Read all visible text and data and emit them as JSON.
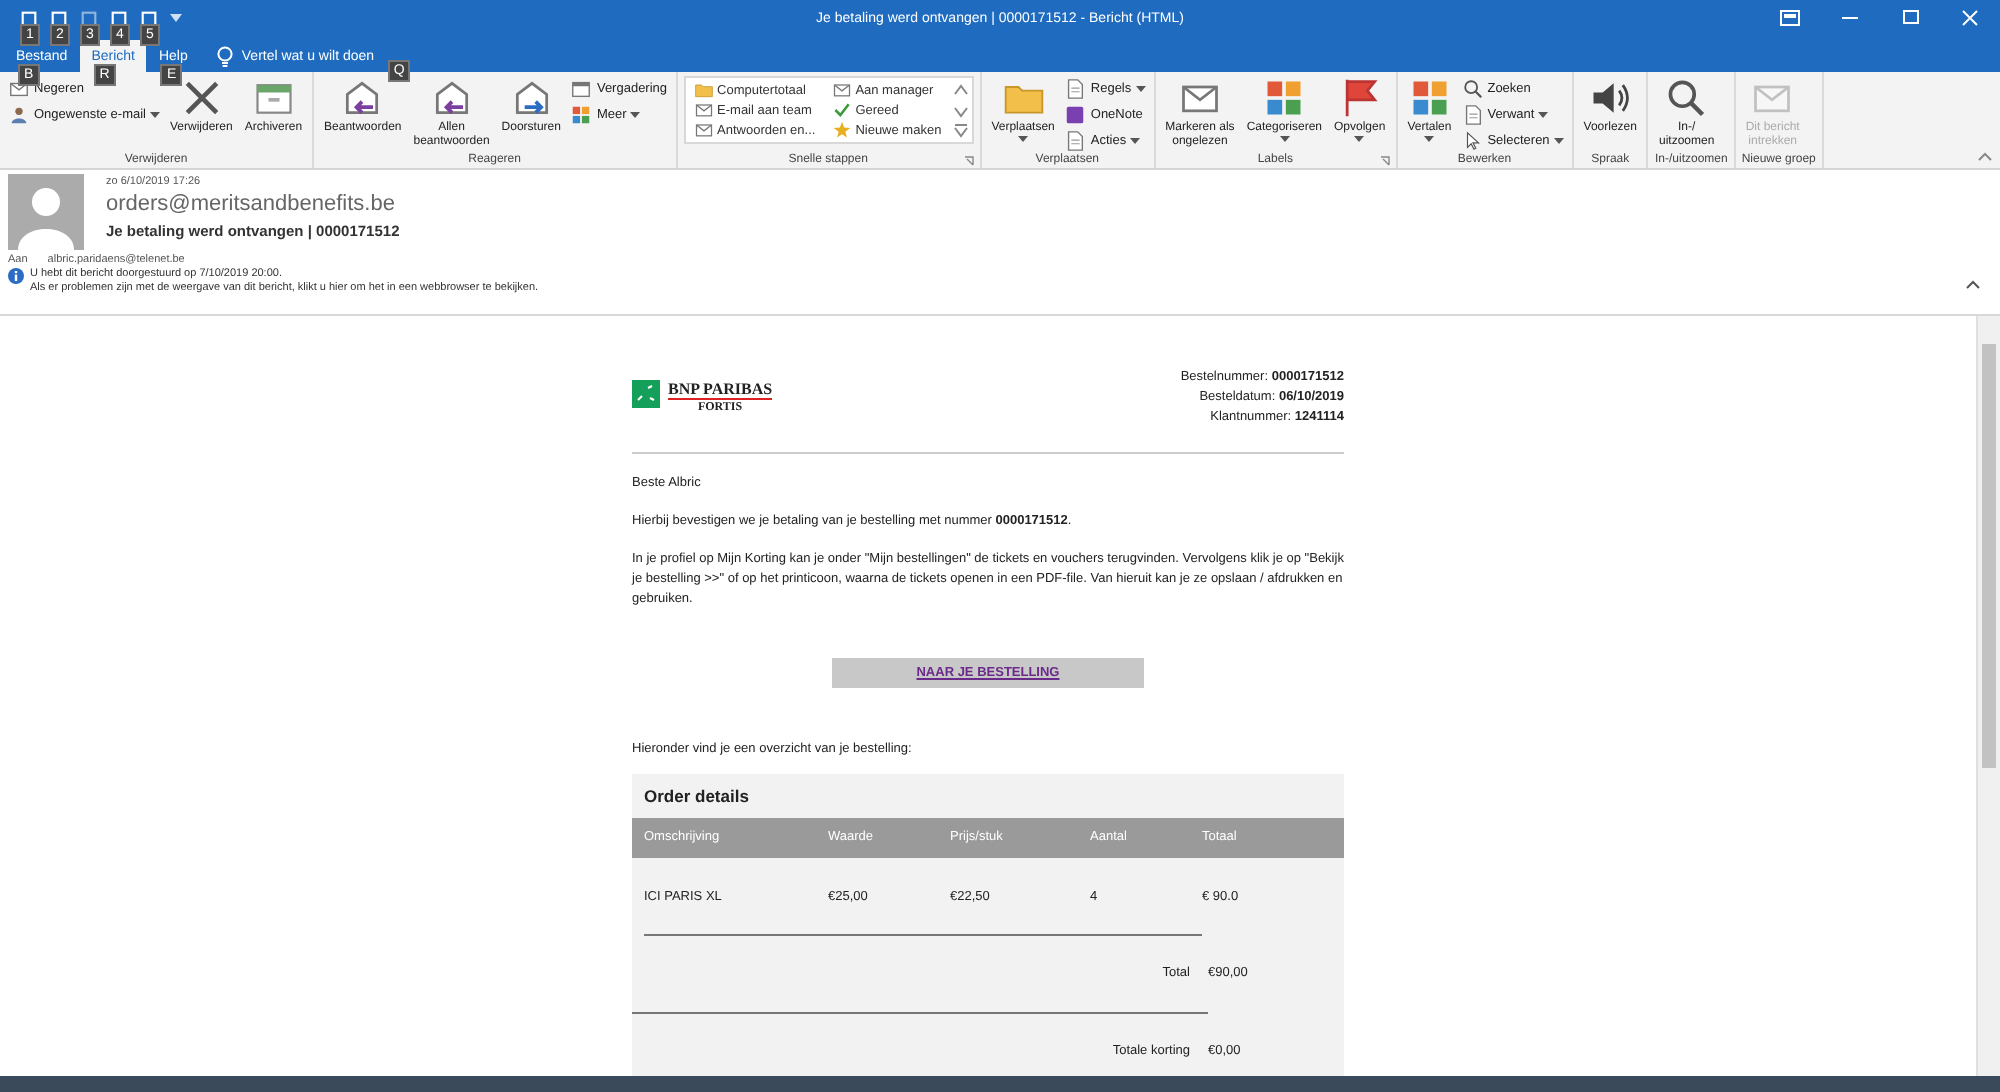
{
  "title_bar": {
    "title": "Je betaling werd ontvangen | 0000171512  -  Bericht (HTML)",
    "quick_access": [
      {
        "keytip": "1"
      },
      {
        "keytip": "2"
      },
      {
        "keytip": "3"
      },
      {
        "keytip": "4"
      },
      {
        "keytip": "5"
      }
    ]
  },
  "tabs": [
    {
      "label": "Bestand",
      "keytip": "B",
      "selected": false
    },
    {
      "label": "Bericht",
      "keytip": "R",
      "selected": true
    },
    {
      "label": "Help",
      "keytip": "E",
      "selected": false
    }
  ],
  "tell_me": {
    "label": "Vertel wat u wilt doen",
    "keytip": "Q"
  },
  "ribbon": [
    {
      "label": "Verwijderen",
      "launcher": false,
      "columns": [
        {
          "kind": "small",
          "items": [
            {
              "lines": [
                "Negeren"
              ],
              "dropdown": false,
              "disabled": false
            },
            {
              "lines": [
                "Ongewenste e-mail"
              ],
              "dropdown": true,
              "disabled": false
            }
          ]
        },
        {
          "kind": "large",
          "items": [
            {
              "lines": [
                "Verwijderen"
              ],
              "dropdown": false,
              "disabled": false
            }
          ]
        },
        {
          "kind": "large",
          "items": [
            {
              "lines": [
                "Archiveren"
              ],
              "dropdown": false,
              "disabled": false
            }
          ]
        }
      ]
    },
    {
      "label": "Reageren",
      "launcher": false,
      "columns": [
        {
          "kind": "large",
          "items": [
            {
              "lines": [
                "Beantwoorden"
              ],
              "dropdown": false,
              "disabled": false
            }
          ]
        },
        {
          "kind": "large",
          "items": [
            {
              "lines": [
                "Allen",
                "beantwoorden"
              ],
              "dropdown": false,
              "disabled": false
            }
          ]
        },
        {
          "kind": "large",
          "items": [
            {
              "lines": [
                "Doorsturen"
              ],
              "dropdown": false,
              "disabled": false
            }
          ]
        },
        {
          "kind": "small",
          "items": [
            {
              "lines": [
                "Vergadering"
              ],
              "dropdown": false,
              "disabled": false
            },
            {
              "lines": [
                "Meer"
              ],
              "dropdown": true,
              "disabled": false
            }
          ]
        }
      ]
    },
    {
      "label": "Snelle stappen",
      "launcher": true,
      "columns": [
        {
          "kind": "gallery",
          "items": [
            {
              "lines": [
                "Computertotaal"
              ],
              "dropdown": false,
              "disabled": false
            },
            {
              "lines": [
                "E-mail aan team"
              ],
              "dropdown": false,
              "disabled": false
            },
            {
              "lines": [
                "Antwoorden en..."
              ],
              "dropdown": false,
              "disabled": false
            },
            {
              "lines": [
                "Aan manager"
              ],
              "dropdown": false,
              "disabled": false
            },
            {
              "lines": [
                "Gereed"
              ],
              "dropdown": false,
              "disabled": false
            },
            {
              "lines": [
                "Nieuwe maken"
              ],
              "dropdown": false,
              "disabled": false
            }
          ]
        }
      ]
    },
    {
      "label": "Verplaatsen",
      "launcher": false,
      "columns": [
        {
          "kind": "large",
          "items": [
            {
              "lines": [
                "Verplaatsen"
              ],
              "dropdown": true,
              "disabled": false
            }
          ]
        },
        {
          "kind": "small",
          "items": [
            {
              "lines": [
                "Regels"
              ],
              "dropdown": true,
              "disabled": false
            },
            {
              "lines": [
                "OneNote"
              ],
              "dropdown": false,
              "disabled": false
            },
            {
              "lines": [
                "Acties"
              ],
              "dropdown": true,
              "disabled": false
            }
          ]
        }
      ]
    },
    {
      "label": "Labels",
      "launcher": true,
      "columns": [
        {
          "kind": "large",
          "items": [
            {
              "lines": [
                "Markeren als",
                "ongelezen"
              ],
              "dropdown": false,
              "disabled": false
            }
          ]
        },
        {
          "kind": "large",
          "items": [
            {
              "lines": [
                "Categoriseren"
              ],
              "dropdown": true,
              "disabled": false
            }
          ]
        },
        {
          "kind": "large",
          "items": [
            {
              "lines": [
                "Opvolgen"
              ],
              "dropdown": true,
              "disabled": false
            }
          ]
        }
      ]
    },
    {
      "label": "Bewerken",
      "launcher": false,
      "columns": [
        {
          "kind": "large",
          "items": [
            {
              "lines": [
                "Vertalen"
              ],
              "dropdown": true,
              "disabled": false
            }
          ]
        },
        {
          "kind": "small",
          "items": [
            {
              "lines": [
                "Zoeken"
              ],
              "dropdown": false,
              "disabled": false
            },
            {
              "lines": [
                "Verwant"
              ],
              "dropdown": true,
              "disabled": false
            },
            {
              "lines": [
                "Selecteren"
              ],
              "dropdown": true,
              "disabled": false
            }
          ]
        }
      ]
    },
    {
      "label": "Spraak",
      "launcher": false,
      "columns": [
        {
          "kind": "large",
          "items": [
            {
              "lines": [
                "Voorlezen"
              ],
              "dropdown": false,
              "disabled": false
            }
          ]
        }
      ]
    },
    {
      "label": "In-/uitzoomen",
      "launcher": false,
      "columns": [
        {
          "kind": "large",
          "items": [
            {
              "lines": [
                "In-/",
                "uitzoomen"
              ],
              "dropdown": false,
              "disabled": false
            }
          ]
        }
      ]
    },
    {
      "label": "Nieuwe groep",
      "launcher": false,
      "columns": [
        {
          "kind": "large",
          "items": [
            {
              "lines": [
                "Dit bericht",
                "intrekken"
              ],
              "dropdown": false,
              "disabled": true
            }
          ]
        }
      ]
    }
  ],
  "message": {
    "date": "zo 6/10/2019 17:26",
    "from": "orders@meritsandbenefits.be",
    "subject": "Je betaling werd ontvangen | 0000171512",
    "to_label": "Aan",
    "to": "albric.paridaens@telenet.be",
    "info": [
      "U hebt dit bericht doorgestuurd op 7/10/2019 20:00.",
      "Als er problemen zijn met de weergave van dit bericht, klikt u hier om het in een webbrowser te bekijken."
    ]
  },
  "email": {
    "logo": {
      "name": "BNP PARIBAS",
      "sub": "FORTIS"
    },
    "meta": [
      "Bestelnummer: **0000171512**",
      "Besteldatum: **06/10/2019**",
      "Klantnummer: **1241114**"
    ],
    "greeting": "Beste Albric",
    "paragraphs": [
      "Hierbij bevestigen we je betaling van je bestelling met nummer **0000171512**.",
      "In je profiel op Mijn Korting kan je onder \"Mijn bestellingen\" de tickets en vouchers terugvinden. Vervolgens klik je op \"Bekijk je bestelling >>\" of op het printicoon, waarna de tickets openen in een PDF-file. Van hieruit kan je ze opslaan / afdrukken en gebruiken."
    ],
    "button": "NAAR JE BESTELLING",
    "intro": "Hieronder vind je een overzicht van je bestelling:",
    "order": {
      "title": "Order details",
      "columns": [
        "Omschrijving",
        "Waarde",
        "Prijs/stuk",
        "Aantal",
        "Totaal"
      ],
      "rows": [
        [
          "ICI PARIS XL",
          "€25,00",
          "€22,50",
          "4",
          "€ 90.0"
        ]
      ],
      "totals": [
        {
          "label": "Total",
          "value": "€90,00"
        },
        {
          "label": "Totale korting",
          "value": "€0,00"
        }
      ]
    }
  }
}
